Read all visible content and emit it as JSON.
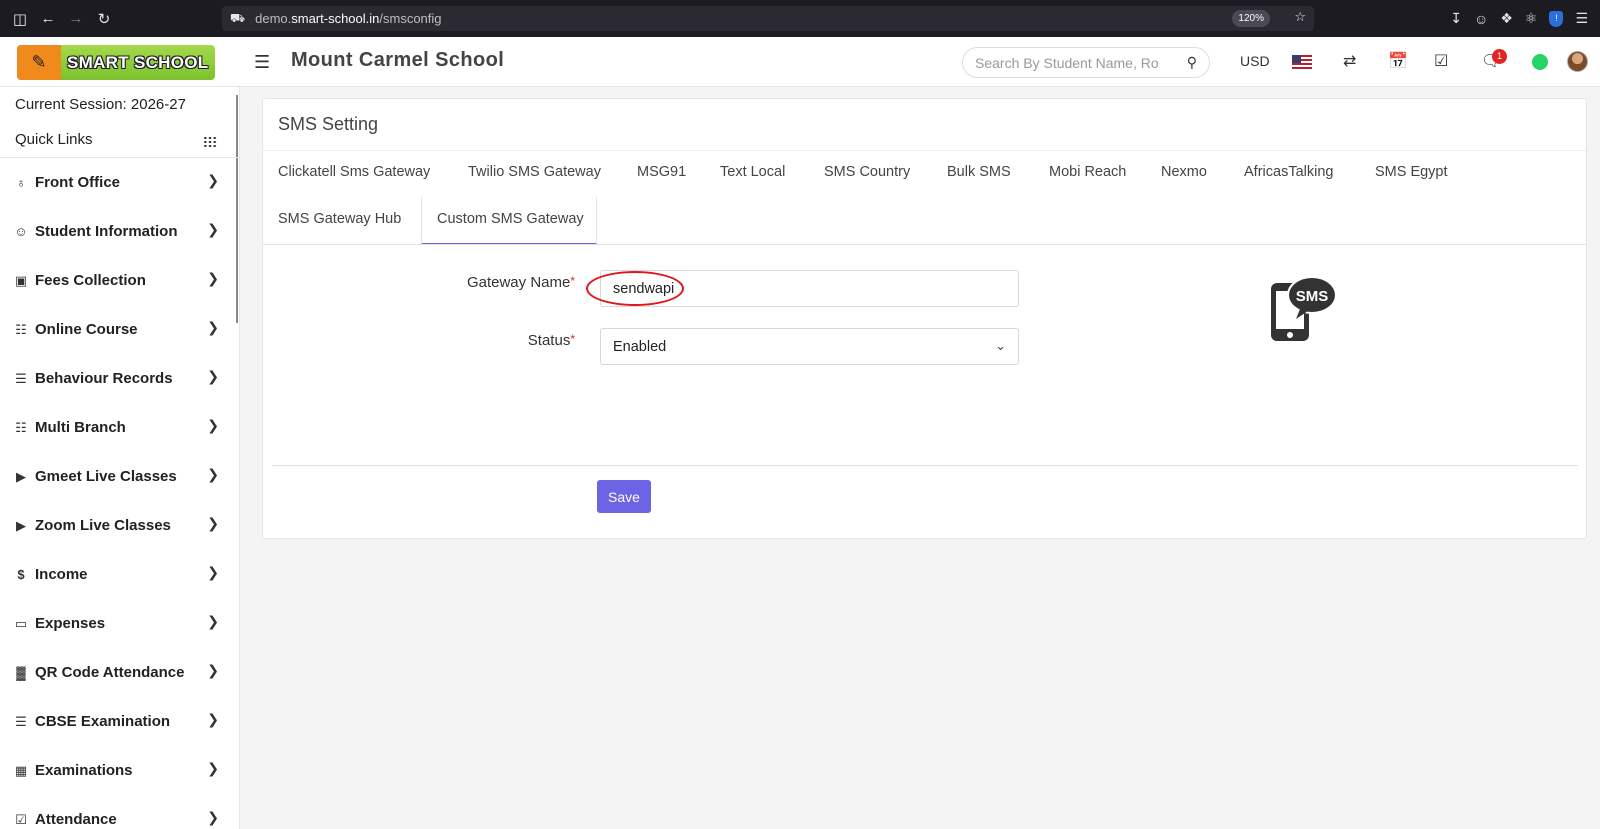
{
  "browser": {
    "url_prefix": "demo.",
    "url_host": "smart-school.in",
    "url_path": "/smsconfig",
    "zoom": "120%"
  },
  "header": {
    "logo_text": "SMART SCHOOL",
    "school_name": "Mount Carmel School",
    "search_placeholder": "Search By Student Name, Ro",
    "currency": "USD",
    "notification_count": "1"
  },
  "sidebar": {
    "session": "Current Session: 2026-27",
    "quick_links": "Quick Links",
    "items": [
      {
        "label": "Front Office",
        "icon": "front-office-icon"
      },
      {
        "label": "Student Information",
        "icon": "user-plus-icon"
      },
      {
        "label": "Fees Collection",
        "icon": "money-icon"
      },
      {
        "label": "Online Course",
        "icon": "course-icon"
      },
      {
        "label": "Behaviour Records",
        "icon": "signpost-icon"
      },
      {
        "label": "Multi Branch",
        "icon": "sitemap-icon"
      },
      {
        "label": "Gmeet Live Classes",
        "icon": "video-icon"
      },
      {
        "label": "Zoom Live Classes",
        "icon": "video-icon"
      },
      {
        "label": "Income",
        "icon": "dollar-icon"
      },
      {
        "label": "Expenses",
        "icon": "credit-card-icon"
      },
      {
        "label": "QR Code Attendance",
        "icon": "qrcode-icon"
      },
      {
        "label": "CBSE Examination",
        "icon": "document-icon"
      },
      {
        "label": "Examinations",
        "icon": "map-icon"
      },
      {
        "label": "Attendance",
        "icon": "calendar-check-icon"
      }
    ]
  },
  "page": {
    "title": "SMS Setting",
    "tabs": [
      "Clickatell Sms Gateway",
      "Twilio SMS Gateway",
      "MSG91",
      "Text Local",
      "SMS Country",
      "Bulk SMS",
      "Mobi Reach",
      "Nexmo",
      "AfricasTalking",
      "SMS Egypt",
      "SMS Gateway Hub",
      "Custom SMS Gateway"
    ],
    "active_tab": "Custom SMS Gateway",
    "form": {
      "gateway_name_label": "Gateway Name",
      "gateway_name_value": "sendwapi",
      "status_label": "Status",
      "status_value": "Enabled",
      "required_mark": "*"
    },
    "save_label": "Save",
    "sms_graphic_text": "SMS"
  },
  "colors": {
    "accent": "#6c63e5",
    "required": "#e02424",
    "annotation": "#e0161b"
  }
}
